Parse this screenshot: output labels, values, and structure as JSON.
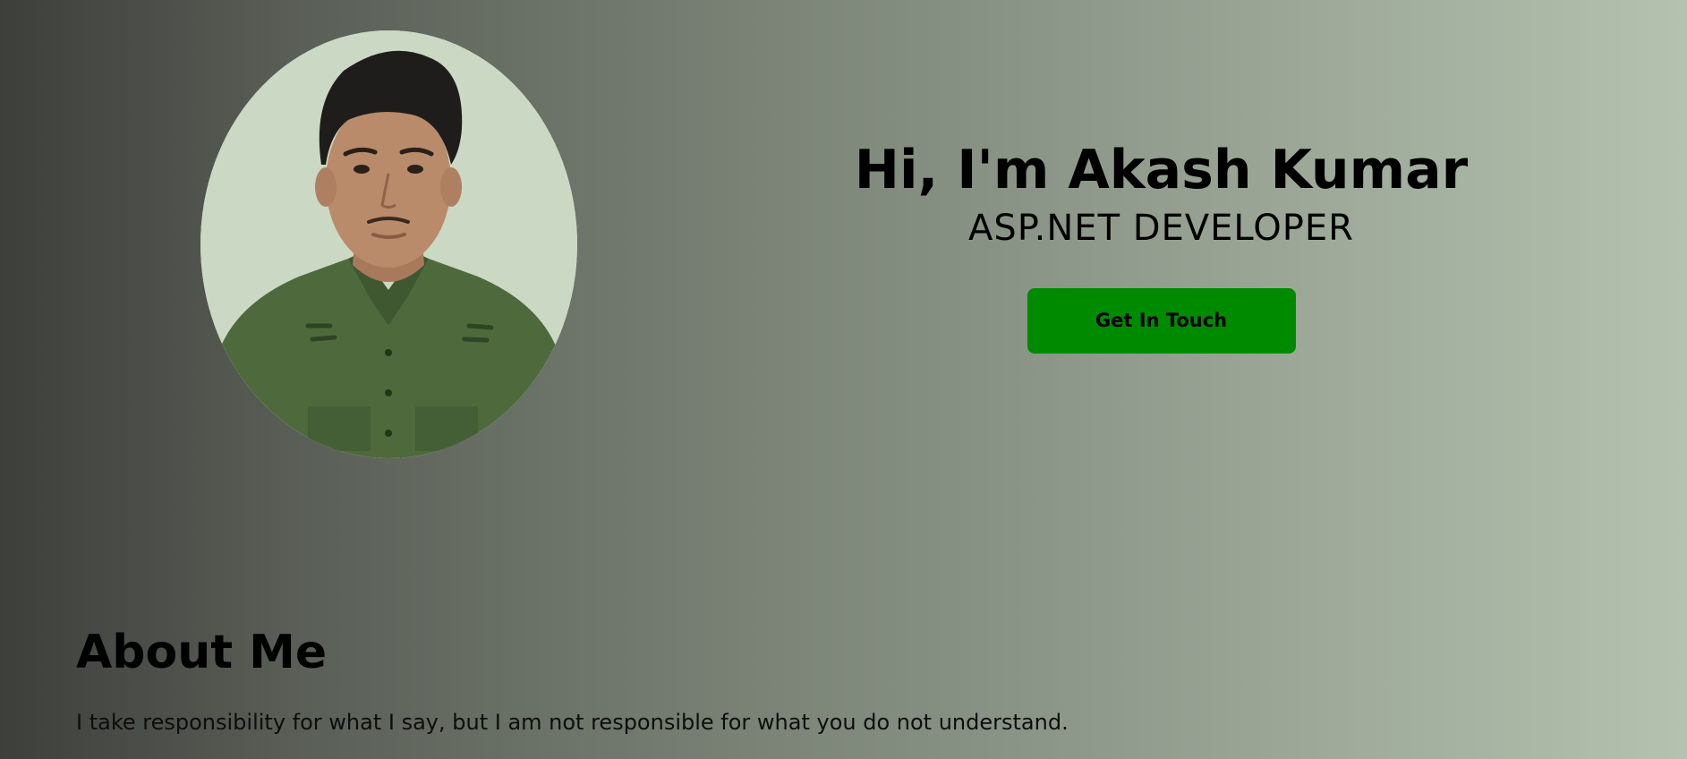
{
  "hero": {
    "avatar": {
      "icon": "profile-photo",
      "alt": "",
      "colors": {
        "background": "#cbd8c3",
        "shirt": "#4e6a3c",
        "skin": "#b98b6a",
        "hair": "#1f1d1b"
      }
    },
    "greeting": "Hi, I'm Akash Kumar",
    "role": "ASP.NET DEVELOPER",
    "cta_label": "Get In Touch",
    "accent_color": "#008a00"
  },
  "about": {
    "title": "About Me",
    "body": "I take responsibility for what I say, but I am not responsible for what you do not understand."
  }
}
